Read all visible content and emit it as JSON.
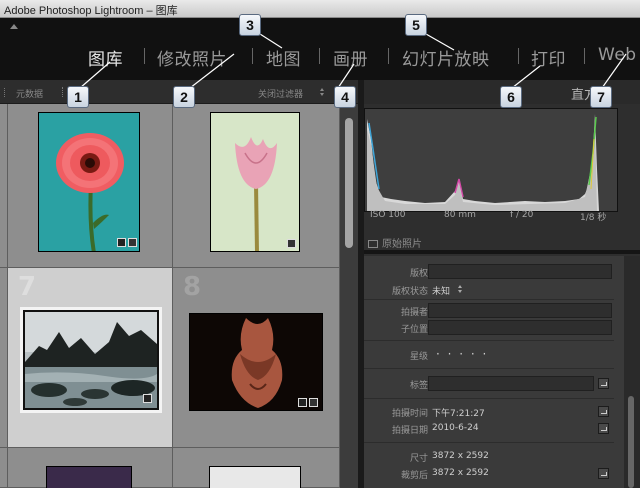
{
  "window": {
    "title": "Adobe Photoshop Lightroom – 图库"
  },
  "modules": [
    {
      "label": "图库",
      "active": true
    },
    {
      "label": "修改照片",
      "active": false
    },
    {
      "label": "地图",
      "active": false
    },
    {
      "label": "画册",
      "active": false
    },
    {
      "label": "幻灯片放映",
      "active": false
    },
    {
      "label": "打印",
      "active": false
    },
    {
      "label": "Web",
      "active": false
    }
  ],
  "filter_bar": {
    "left_label": "元数据",
    "right_label": "关闭过滤器"
  },
  "grid": {
    "cells": [
      {
        "index": "",
        "photo": "pink-gerbera"
      },
      {
        "index": "",
        "photo": "pink-tulip"
      },
      {
        "index": "7",
        "photo": "rocky-coast",
        "selected": true
      },
      {
        "index": "8",
        "photo": "body-study"
      }
    ]
  },
  "right_panel": {
    "title": "直方图",
    "histogram_stats": {
      "iso": "ISO 100",
      "focal": "80 mm",
      "aperture": "f / 20",
      "shutter": "1/8 秒"
    },
    "original_photo_label": "原始照片",
    "metadata": {
      "copyright_label": "版权",
      "copyright_status_label": "版权状态",
      "copyright_status_value": "未知",
      "photographer_label": "拍摄者",
      "sublocation_label": "子位置",
      "rating_label": "星级",
      "rating_value": "· · · · ·",
      "label_label": "标签",
      "capture_time_label": "拍摄时间",
      "capture_time_value": "下午7:21:27",
      "capture_date_label": "拍摄日期",
      "capture_date_value": "2010-6-24",
      "dimensions_label": "尺寸",
      "dimensions_value": "3872 x 2592",
      "cropped_label": "裁剪后",
      "cropped_value": "3872 x 2592"
    }
  },
  "callouts": [
    "1",
    "2",
    "3",
    "4",
    "5",
    "6",
    "7"
  ],
  "colors": {
    "module_active": "#e6e6e6",
    "module_inactive": "#9a9a9a",
    "callout_border": "#5a6a80"
  }
}
